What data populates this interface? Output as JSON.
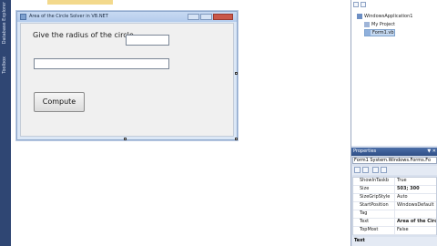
{
  "left_strip": {
    "tabs": [
      "Database Explorer",
      "Toolbox"
    ]
  },
  "form": {
    "title": "Area of the Circle Solver in VB.NET",
    "label": "Give the radius of the circle",
    "compute_button": "Compute"
  },
  "solution_explorer": {
    "items": [
      "WindowsApplication1",
      "My Project",
      "Form1.vb"
    ]
  },
  "properties": {
    "title": "Properties",
    "pin": "▼ ✕",
    "object": "Form1 System.Windows.Forms.Fo",
    "rows": [
      {
        "name": "ShowInTaskb",
        "value": "True"
      },
      {
        "name": "Size",
        "value": "503; 300"
      },
      {
        "name": "SizeGripStyle",
        "value": "Auto"
      },
      {
        "name": "StartPosition",
        "value": "WindowsDefault"
      },
      {
        "name": "Tag",
        "value": ""
      },
      {
        "name": "Text",
        "value": "Area of the Circ"
      },
      {
        "name": "TopMost",
        "value": "False"
      }
    ],
    "description": "Text"
  }
}
